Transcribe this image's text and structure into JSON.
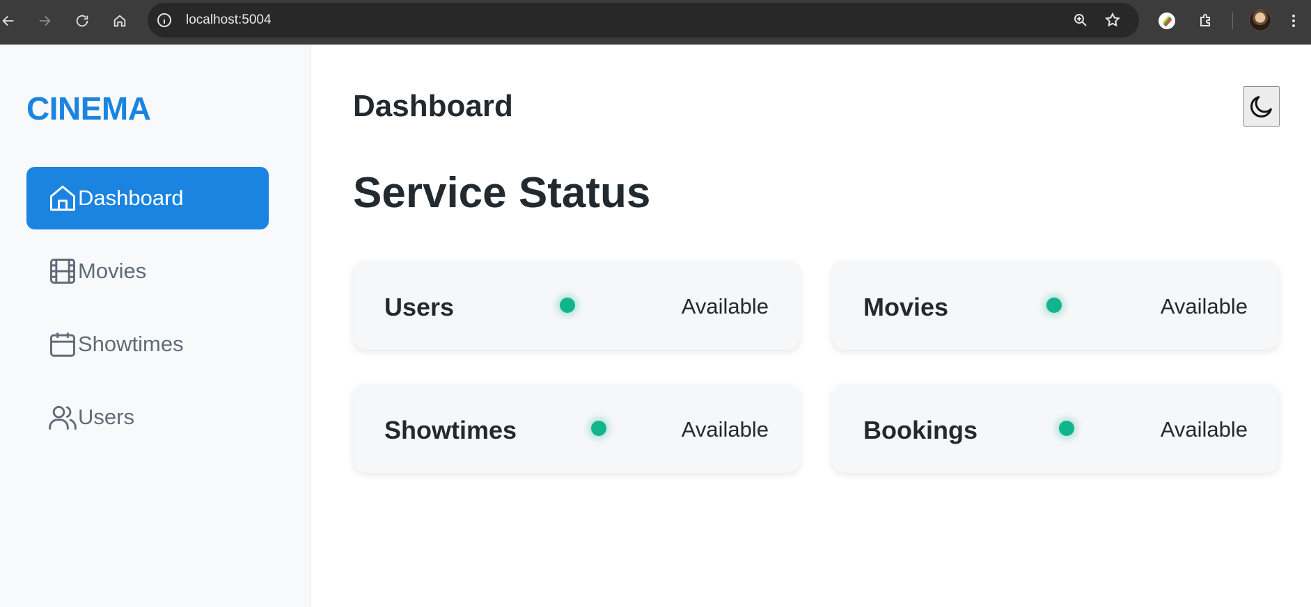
{
  "browser": {
    "url": "localhost:5004",
    "icons": [
      "back-icon",
      "forward-icon",
      "reload-icon",
      "home-icon",
      "site-info-icon",
      "zoom-icon",
      "bookmark-star-icon",
      "extension-color-icon",
      "extensions-puzzle-icon",
      "profile-avatar",
      "kebab-menu-icon"
    ]
  },
  "sidebar": {
    "brand": "CINEMA",
    "items": [
      {
        "label": "Dashboard",
        "icon": "home-icon",
        "active": true
      },
      {
        "label": "Movies",
        "icon": "film-icon",
        "active": false
      },
      {
        "label": "Showtimes",
        "icon": "calendar-icon",
        "active": false
      },
      {
        "label": "Users",
        "icon": "users-icon",
        "active": false
      }
    ]
  },
  "header": {
    "title": "Dashboard",
    "theme_toggle_icon": "moon-icon"
  },
  "main": {
    "section_title": "Service Status",
    "services": [
      {
        "name": "Users",
        "status": "Available"
      },
      {
        "name": "Movies",
        "status": "Available"
      },
      {
        "name": "Showtimes",
        "status": "Available"
      },
      {
        "name": "Bookings",
        "status": "Available"
      }
    ]
  },
  "colors": {
    "accent": "#1a84e0",
    "status_ok": "#12b48c",
    "text_dark": "#222a30",
    "nav_muted": "#5f6b78"
  }
}
